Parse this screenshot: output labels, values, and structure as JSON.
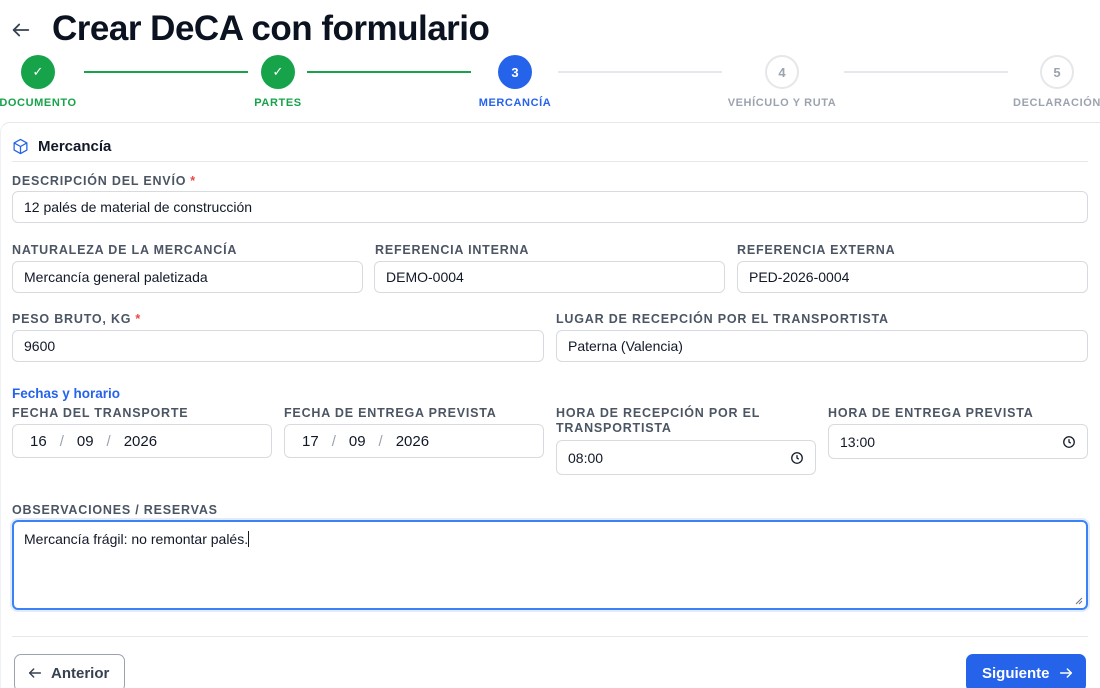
{
  "header": {
    "title": "Crear DeCA con formulario"
  },
  "stepper": {
    "steps": [
      {
        "number": "✓",
        "label": "DOCUMENTO",
        "state": "done"
      },
      {
        "number": "✓",
        "label": "PARTES",
        "state": "done"
      },
      {
        "number": "3",
        "label": "MERCANCÍA",
        "state": "active"
      },
      {
        "number": "4",
        "label": "VEHÍCULO Y RUTA",
        "state": "pending"
      },
      {
        "number": "5",
        "label": "DECLARACIÓN",
        "state": "pending"
      }
    ]
  },
  "section": {
    "icon": "package-icon",
    "title": "Mercancía"
  },
  "fields": {
    "descripcion": {
      "label": "DESCRIPCIÓN DEL ENVÍO",
      "required": "*",
      "value": "12 palés de material de construcción"
    },
    "naturaleza": {
      "label": "NATURALEZA DE LA MERCANCÍA",
      "value": "Mercancía general paletizada"
    },
    "ref_interna": {
      "label": "REFERENCIA INTERNA",
      "value": "DEMO-0004"
    },
    "ref_externa": {
      "label": "REFERENCIA EXTERNA",
      "value": "PED-2026-0004"
    },
    "peso": {
      "label": "PESO BRUTO, KG",
      "required": "*",
      "value": "9600"
    },
    "lugar": {
      "label": "LUGAR DE RECEPCIÓN POR EL TRANSPORTISTA",
      "value": "Paterna (Valencia)"
    }
  },
  "fechas": {
    "title": "Fechas y horario",
    "fecha_transporte": {
      "label": "FECHA DEL TRANSPORTE",
      "day": "16",
      "month": "09",
      "year": "2026",
      "sep": "/"
    },
    "fecha_entrega": {
      "label": "FECHA DE ENTREGA PREVISTA",
      "day": "17",
      "month": "09",
      "year": "2026",
      "sep": "/"
    },
    "hora_recepcion": {
      "label_line1": "HORA DE RECEPCIÓN POR EL",
      "label_line2": "TRANSPORTISTA",
      "value": "08:00"
    },
    "hora_entrega": {
      "label": "HORA DE ENTREGA PREVISTA",
      "value": "13:00"
    }
  },
  "observaciones": {
    "label": "OBSERVACIONES / RESERVAS",
    "value": "Mercancía frágil: no remontar palés."
  },
  "footer": {
    "prev_label": "Anterior",
    "next_label": "Siguiente"
  },
  "colors": {
    "done": "#16a34a",
    "active": "#2563eb",
    "pending": "#9ca3af",
    "required": "#ef4444"
  }
}
